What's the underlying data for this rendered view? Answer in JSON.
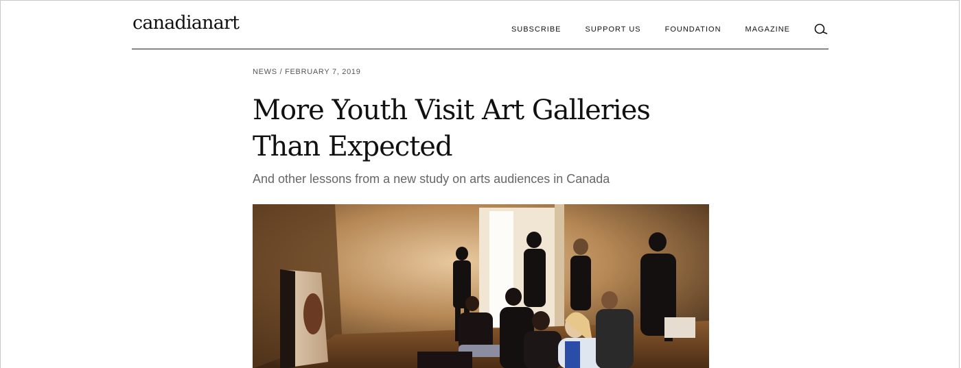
{
  "header": {
    "logo": "canadianart",
    "nav": {
      "subscribe": "SUBSCRIBE",
      "support": "SUPPORT US",
      "foundation": "FOUNDATION",
      "magazine": "MAGAZINE"
    },
    "search_icon": "search-icon"
  },
  "article": {
    "category": "NEWS",
    "separator": " / ",
    "date": "FEBRUARY 7, 2019",
    "title": "More Youth Visit Art Galleries Than Expected",
    "subtitle": "And other lessons from a new study on arts audiences in Canada",
    "hero_image": "photo-youth-in-gallery"
  }
}
